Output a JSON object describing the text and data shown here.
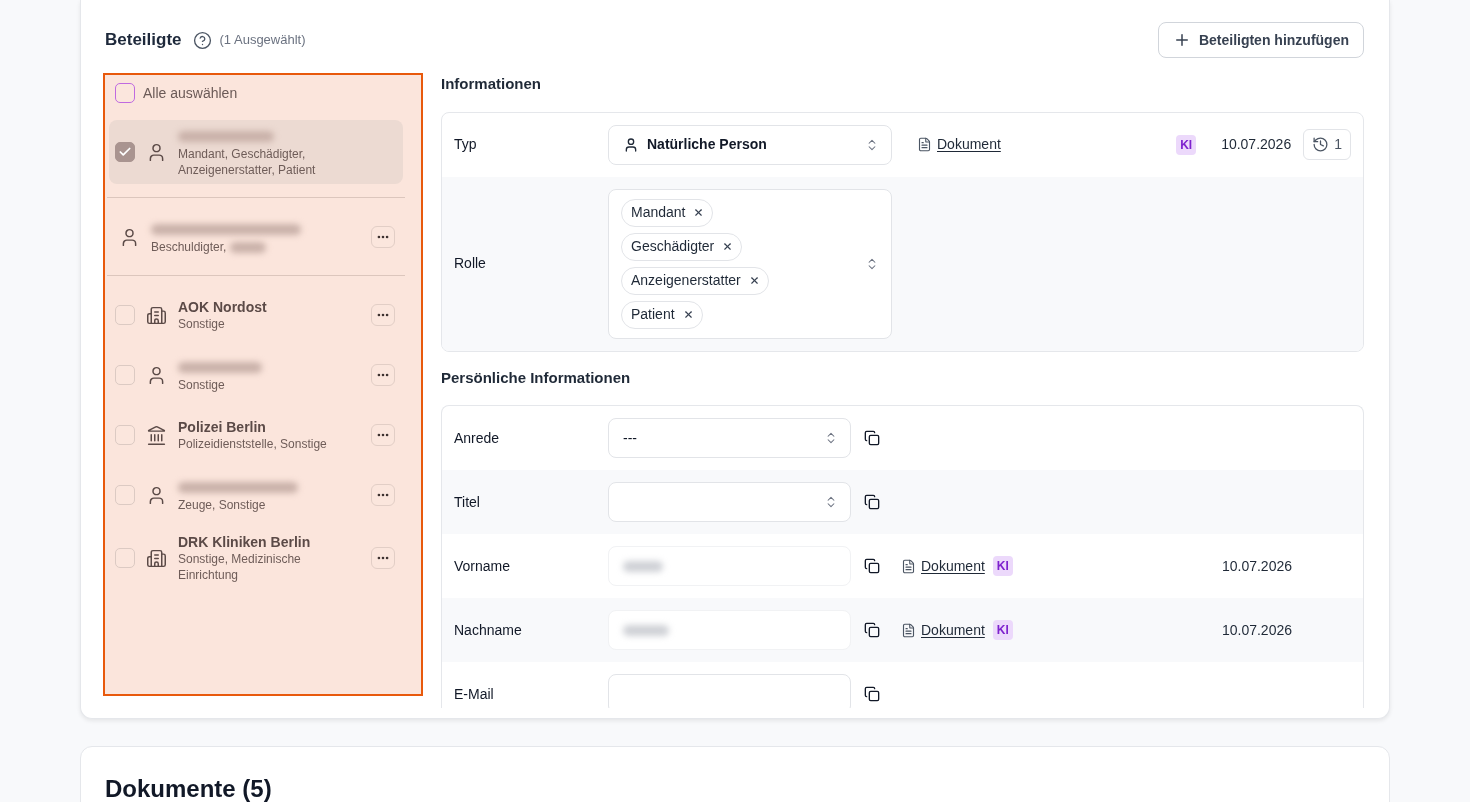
{
  "section": {
    "title": "Beteiligte",
    "selection_count": "(1 Ausgewählt)",
    "add_button": "Beteiligten hinzufügen"
  },
  "participants": {
    "select_all": {
      "label": "Alle auswählen",
      "checked": false
    },
    "groups": [
      {
        "items": [
          {
            "kind": "person",
            "name_blurred": true,
            "roles": "Mandant, Geschädigter, Anzeigenerstatter, Patient",
            "has_checkbox": true,
            "checked": true,
            "selected": true,
            "menu": false
          }
        ]
      },
      {
        "items": [
          {
            "kind": "person",
            "name_blurred": true,
            "roles": "Beschuldigter,",
            "roles_blurred_tail": true,
            "has_checkbox": false,
            "selected": false,
            "menu": true
          }
        ]
      },
      {
        "items": [
          {
            "kind": "organization",
            "name": "AOK Nordost",
            "name_blurred": false,
            "roles": "Sonstige",
            "has_checkbox": true,
            "checked": false,
            "selected": false,
            "menu": true
          },
          {
            "kind": "person",
            "name_blurred": true,
            "roles": "Sonstige",
            "has_checkbox": true,
            "checked": false,
            "selected": false,
            "menu": true
          },
          {
            "kind": "authority",
            "name": "Polizei Berlin",
            "name_blurred": false,
            "roles": "Polizeidienststelle, Sonstige",
            "has_checkbox": true,
            "checked": false,
            "selected": false,
            "menu": true
          },
          {
            "kind": "person",
            "name_blurred": true,
            "roles": "Zeuge, Sonstige",
            "has_checkbox": true,
            "checked": false,
            "selected": false,
            "menu": true
          },
          {
            "kind": "organization",
            "name": "DRK Kliniken Berlin",
            "name_blurred": false,
            "roles": "Sonstige, Medizinische Einrichtung",
            "has_checkbox": true,
            "checked": false,
            "selected": false,
            "menu": true
          }
        ]
      }
    ]
  },
  "informationen": {
    "title": "Informationen",
    "rows": [
      {
        "kind": "type-select",
        "label": "Typ",
        "value": "Natürliche Person",
        "source": "Dokument",
        "badge": "KI",
        "date": "10.07.2026",
        "history_count": "1"
      },
      {
        "kind": "multi-select",
        "label": "Rolle",
        "chips": [
          "Mandant",
          "Geschädigter",
          "Anzeigenerstatter",
          "Patient"
        ]
      }
    ]
  },
  "persoenliche_informationen": {
    "title": "Persönliche Informationen",
    "rows": [
      {
        "kind": "select",
        "label": "Anrede",
        "value": "---"
      },
      {
        "kind": "select",
        "label": "Titel"
      },
      {
        "kind": "text",
        "label": "Vorname",
        "value_blurred": true,
        "source": "Dokument",
        "badge": "KI",
        "date": "10.07.2026"
      },
      {
        "kind": "text",
        "label": "Nachname",
        "value_blurred": true,
        "source": "Dokument",
        "badge": "KI",
        "date": "10.07.2026"
      },
      {
        "kind": "text",
        "label": "E-Mail",
        "value_blurred": false
      }
    ]
  },
  "documents": {
    "title": "Dokumente (5)"
  }
}
